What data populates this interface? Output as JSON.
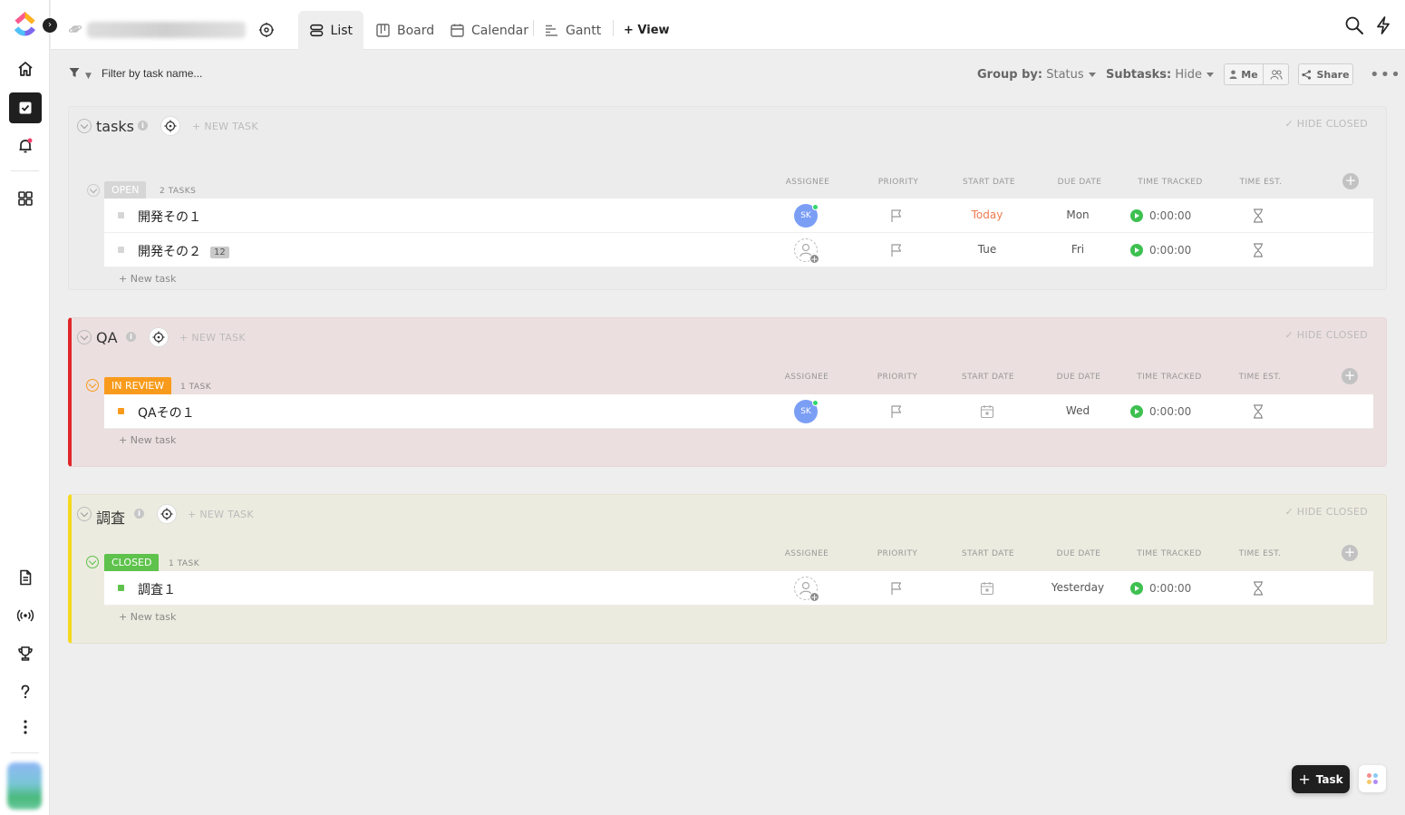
{
  "topbar": {
    "tabs": [
      {
        "label": "List",
        "icon": "list-icon",
        "active": true
      },
      {
        "label": "Board",
        "icon": "board-icon"
      },
      {
        "label": "Calendar",
        "icon": "calendar-icon"
      },
      {
        "label": "Gantt",
        "icon": "gantt-icon"
      }
    ],
    "add_view": "+ View"
  },
  "filterbar": {
    "filter_placeholder": "Filter by task name...",
    "group_by_label": "Group by:",
    "group_by_value": "Status",
    "subtasks_label": "Subtasks:",
    "subtasks_value": "Hide",
    "me_label": "Me",
    "share_label": "Share"
  },
  "columns": [
    "ASSIGNEE",
    "PRIORITY",
    "START DATE",
    "DUE DATE",
    "TIME TRACKED",
    "TIME EST."
  ],
  "groups": [
    {
      "title": "tasks",
      "new_task": "+ NEW TASK",
      "hide_closed": "✓ HIDE CLOSED",
      "status": {
        "label": "OPEN",
        "color": "#d6d6d6",
        "count": "2 TASKS"
      },
      "tasks": [
        {
          "name": "開発その１",
          "assignee": "SK",
          "start": "Today",
          "due": "Mon",
          "time": "0:00:00"
        },
        {
          "name": "開発その２",
          "subtasks": "12",
          "assignee": "",
          "start": "Tue",
          "due": "Fri",
          "time": "0:00:00"
        }
      ],
      "add_task": "+ New task"
    },
    {
      "title": "QA",
      "new_task": "+ NEW TASK",
      "hide_closed": "✓ HIDE CLOSED",
      "accent": "#e0252b",
      "status": {
        "label": "IN REVIEW",
        "color": "#f89b1c",
        "count": "1 TASK"
      },
      "tasks": [
        {
          "name": "QAその１",
          "assignee": "SK",
          "start": "",
          "due": "Wed",
          "time": "0:00:00"
        }
      ],
      "add_task": "+ New task"
    },
    {
      "title": "調査",
      "new_task": "+ NEW TASK",
      "hide_closed": "✓ HIDE CLOSED",
      "accent": "#f4d91c",
      "status": {
        "label": "CLOSED",
        "color": "#5ec24c",
        "count": "1 TASK"
      },
      "tasks": [
        {
          "name": "調査１",
          "assignee": "",
          "start": "",
          "due": "Yesterday",
          "time": "0:00:00"
        }
      ],
      "add_task": "+ New task"
    }
  ],
  "fab": {
    "task_label": "Task"
  }
}
